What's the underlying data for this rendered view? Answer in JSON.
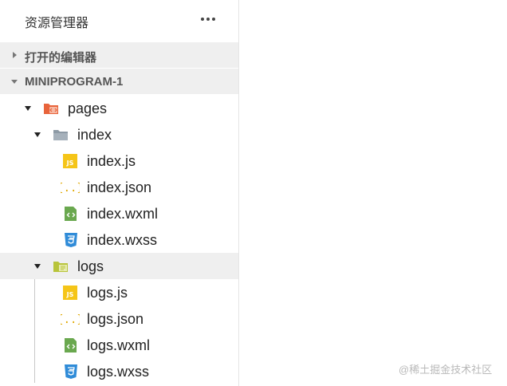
{
  "explorer": {
    "title": "资源管理器",
    "more_icon": "more-horizontal-icon"
  },
  "sections": {
    "open_editors": {
      "label": "打开的编辑器",
      "expanded": false
    },
    "project": {
      "label": "MINIPROGRAM-1",
      "expanded": true
    }
  },
  "tree": {
    "pages": {
      "label": "pages",
      "icon": "pages-folder-icon",
      "expanded": true
    },
    "index": {
      "label": "index",
      "icon": "folder-icon",
      "expanded": true
    },
    "index_js": {
      "label": "index.js",
      "icon": "js-file-icon"
    },
    "index_json": {
      "label": "index.json",
      "icon": "json-file-icon"
    },
    "index_wxml": {
      "label": "index.wxml",
      "icon": "wxml-file-icon"
    },
    "index_wxss": {
      "label": "index.wxss",
      "icon": "css-file-icon"
    },
    "logs": {
      "label": "logs",
      "icon": "logs-folder-icon",
      "expanded": true,
      "selected": true
    },
    "logs_js": {
      "label": "logs.js",
      "icon": "js-file-icon"
    },
    "logs_json": {
      "label": "logs.json",
      "icon": "json-file-icon"
    },
    "logs_wxml": {
      "label": "logs.wxml",
      "icon": "wxml-file-icon"
    },
    "logs_wxss": {
      "label": "logs.wxss",
      "icon": "css-file-icon"
    }
  },
  "colors": {
    "js": "#f5c518",
    "json": "#e0a800",
    "wxml": "#6aa84f",
    "css": "#2f8bd8",
    "pages_folder": "#e8643b",
    "folder": "#8d9aa5",
    "logs_folder": "#b8c43a",
    "section_bg": "#efefef"
  },
  "watermark": "@稀土掘金技术社区"
}
